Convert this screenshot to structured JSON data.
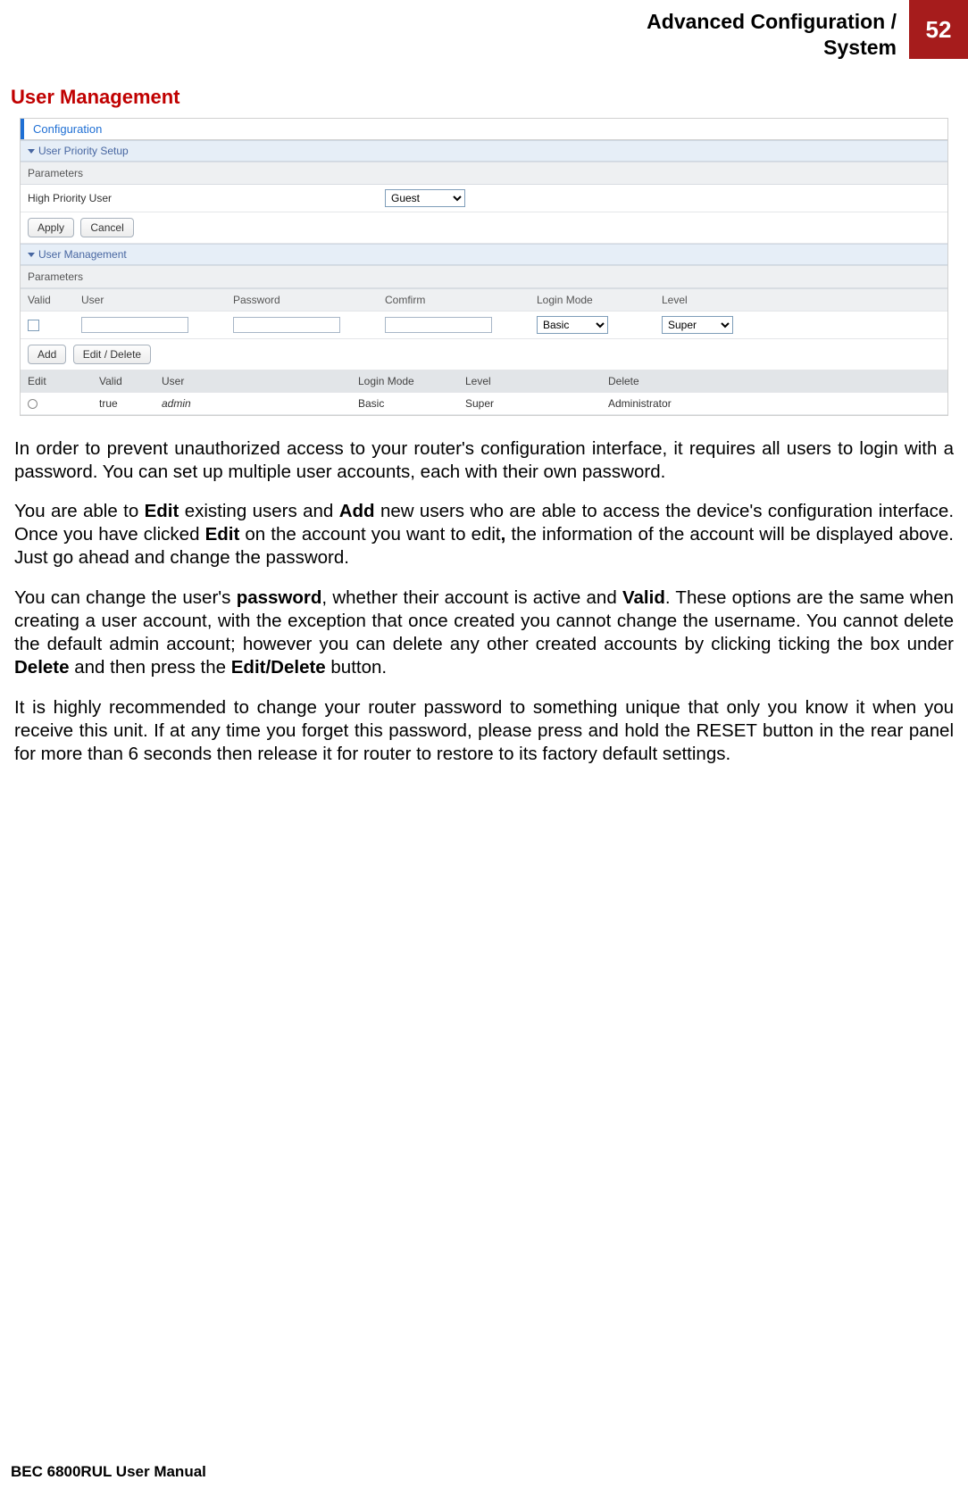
{
  "header": {
    "breadcrumb_line1": "Advanced Configuration /",
    "breadcrumb_line2": "System",
    "page_number": "52"
  },
  "section_title": "User Management",
  "screenshot": {
    "tab": "Configuration",
    "priority": {
      "header": "User Priority Setup",
      "parameters_label": "Parameters",
      "high_priority_user_label": "High Priority User",
      "high_priority_user_value": "Guest",
      "apply": "Apply",
      "cancel": "Cancel"
    },
    "usermgmt": {
      "header": "User Management",
      "parameters_label": "Parameters",
      "cols": {
        "valid": "Valid",
        "user": "User",
        "password": "Password",
        "confirm": "Comfirm",
        "login_mode": "Login Mode",
        "level": "Level"
      },
      "login_mode_value": "Basic",
      "level_value": "Super",
      "add": "Add",
      "edit_delete": "Edit / Delete",
      "list_headers": {
        "edit": "Edit",
        "valid": "Valid",
        "user": "User",
        "login_mode": "Login Mode",
        "level": "Level",
        "delete": "Delete"
      },
      "list_row": {
        "valid": "true",
        "user": "admin",
        "login_mode": "Basic",
        "level": "Super",
        "delete": "Administrator"
      }
    }
  },
  "paragraphs": {
    "p1": "In order to prevent unauthorized access to your router's configuration interface, it requires all users to login with a password. You can set up multiple user accounts, each with their own password.",
    "p2a": "You are able to ",
    "p2_edit": "Edit",
    "p2b": " existing users and ",
    "p2_add": "Add",
    "p2c": " new users who are able to access the device's configuration interface. Once you have clicked ",
    "p2_edit2": "Edit",
    "p2d": " on the account you want to edit",
    "p2_comma": ",",
    "p2e": " the information of the account will be displayed above. Just go ahead and change the password.",
    "p3a": "You can change the user's ",
    "p3_password": "password",
    "p3b": ", whether their account is active and ",
    "p3_valid": "Valid",
    "p3c": ". These options are the same when creating a user account, with the exception that once created you cannot change the username. You cannot delete the default admin account; however you can delete any other created accounts by clicking ticking the box under ",
    "p3_delete": "Delete",
    "p3d": " and then press the ",
    "p3_editdelete": "Edit/Delete",
    "p3e": " button.",
    "p4": "It is highly recommended to change your router password to something unique that only you know it when you receive this unit.  If at any time you forget this password, please press and hold the RESET button in the rear panel for more than 6 seconds then release it for router to restore to its factory default settings."
  },
  "footer": "BEC 6800RUL User Manual"
}
